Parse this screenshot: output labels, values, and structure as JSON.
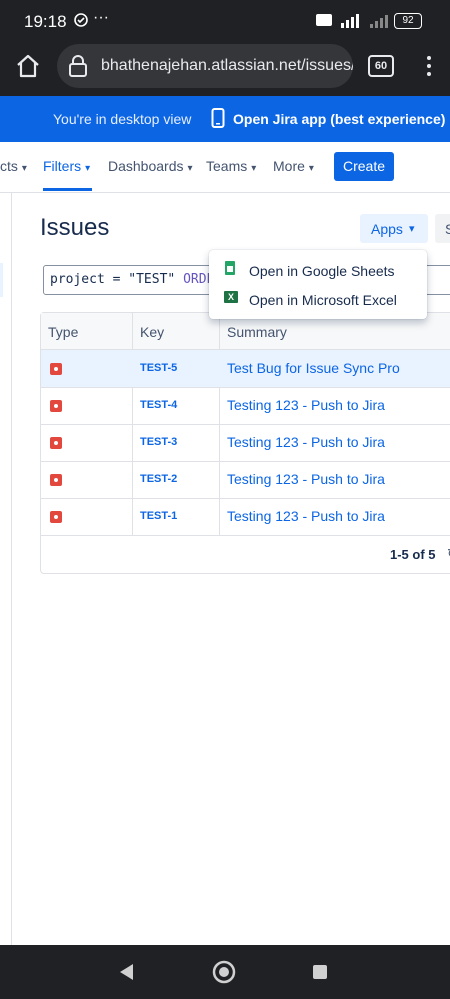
{
  "status_bar": {
    "time": "19:18",
    "battery": "92"
  },
  "browser": {
    "url": "bhathenajehan.atlassian.net/issues/?jq",
    "tabs_count": "60"
  },
  "banner": {
    "desktop_view_text": "You're in desktop view",
    "open_app_text": "Open Jira app (best experience)"
  },
  "nav": {
    "items": [
      {
        "label": "cts"
      },
      {
        "label": "Filters"
      },
      {
        "label": "Dashboards"
      },
      {
        "label": "Teams"
      },
      {
        "label": "More"
      }
    ],
    "create_label": "Create"
  },
  "page": {
    "title": "Issues",
    "apps_label": "Apps",
    "share_label": "S",
    "jql": {
      "prefix": "project = \"TEST\" ",
      "keyword": "ORDE"
    }
  },
  "apps_menu": {
    "items": [
      {
        "label": "Open in Google Sheets"
      },
      {
        "label": "Open in Microsoft Excel"
      }
    ]
  },
  "table": {
    "headers": {
      "type": "Type",
      "key": "Key",
      "summary": "Summary"
    },
    "rows": [
      {
        "key": "TEST-5",
        "summary": "Test Bug for Issue Sync Pro"
      },
      {
        "key": "TEST-4",
        "summary": "Testing 123 - Push to Jira"
      },
      {
        "key": "TEST-3",
        "summary": "Testing 123 - Push to Jira"
      },
      {
        "key": "TEST-2",
        "summary": "Testing 123 - Push to Jira"
      },
      {
        "key": "TEST-1",
        "summary": "Testing 123 - Push to Jira"
      }
    ],
    "pagination": "1-5 of 5"
  },
  "colors": {
    "brand": "#0c66e4",
    "bug": "#e2483d",
    "browser_chrome": "#202124"
  },
  "icons": [
    "home-icon",
    "lock-icon",
    "kebab-menu-icon",
    "phone-icon",
    "bug-icon",
    "sheets-icon",
    "excel-icon",
    "refresh-icon",
    "back-icon",
    "home-circle-icon",
    "recents-icon"
  ]
}
